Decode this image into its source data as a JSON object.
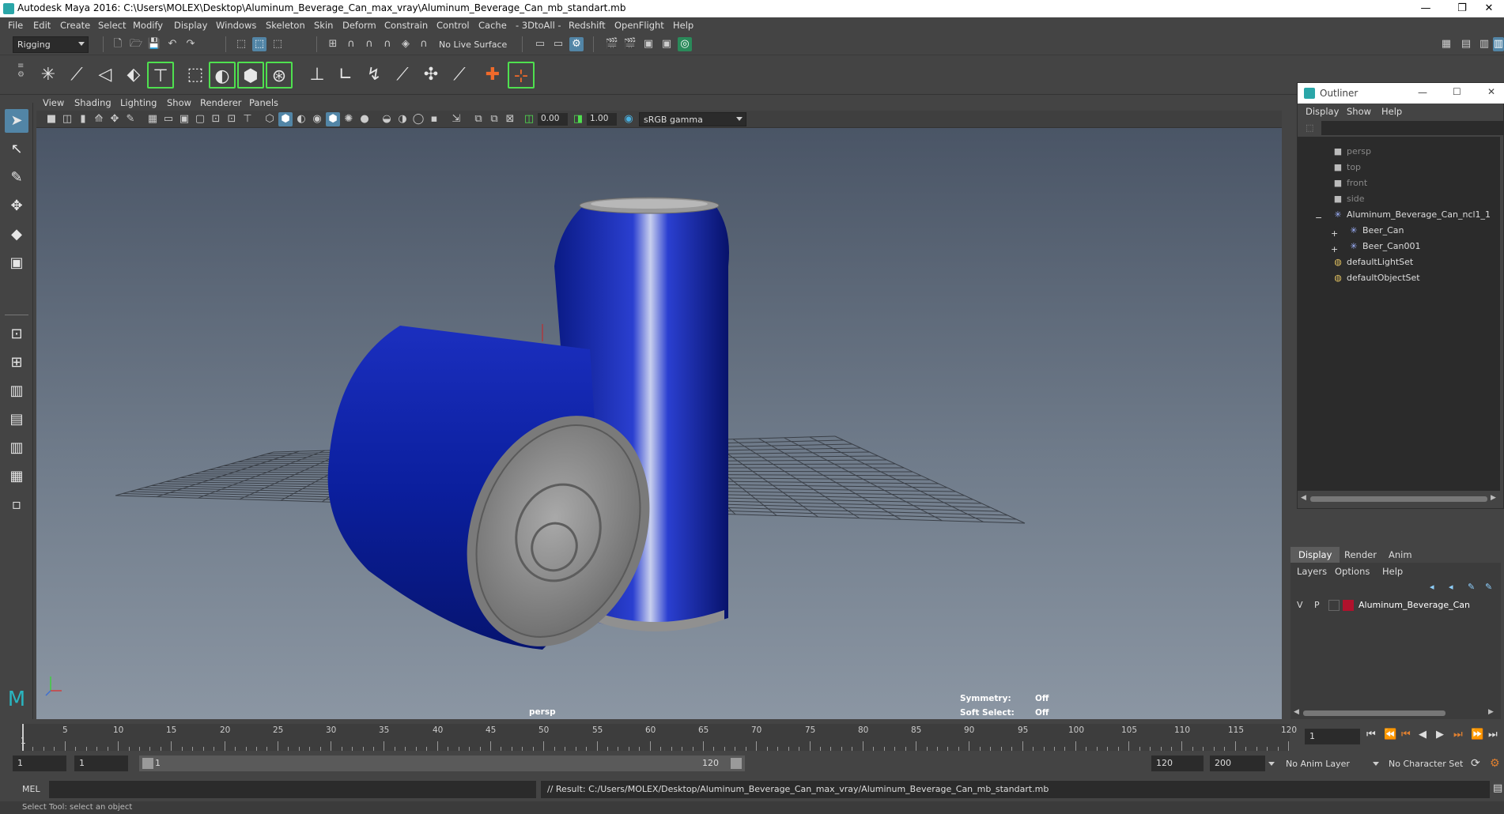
{
  "titlebar": {
    "title": "Autodesk Maya 2016: C:\\Users\\MOLEX\\Desktop\\Aluminum_Beverage_Can_max_vray\\Aluminum_Beverage_Can_mb_standart.mb",
    "minimize": "—",
    "restore": "❐",
    "close": "✕"
  },
  "menubar": [
    "File",
    "Edit",
    "Create",
    "Select",
    "Modify",
    "Display",
    "Windows",
    "Skeleton",
    "Skin",
    "Deform",
    "Constrain",
    "Control",
    "Cache",
    "- 3DtoAll -",
    "Redshift",
    "OpenFlight",
    "Help"
  ],
  "statusline": {
    "menuset": "Rigging",
    "live_surface": "No Live Surface"
  },
  "panel": {
    "menu": [
      "View",
      "Shading",
      "Lighting",
      "Show",
      "Renderer",
      "Panels"
    ],
    "exposure": "0.00",
    "gamma": "1.00",
    "colorspace": "sRGB gamma"
  },
  "viewport": {
    "camera_label": "persp",
    "symmetry_label": "Symmetry:",
    "symmetry_value": "Off",
    "soft_select_label": "Soft Select:",
    "soft_select_value": "Off",
    "can_color": "#0b1f9e",
    "lid_color": "#8a8a8a"
  },
  "outliner": {
    "title": "Outliner",
    "menu": [
      "Display",
      "Show",
      "Help"
    ],
    "items": [
      {
        "label": "persp",
        "icon": "camera-icon",
        "dim": true
      },
      {
        "label": "top",
        "icon": "camera-icon",
        "dim": true
      },
      {
        "label": "front",
        "icon": "camera-icon",
        "dim": true
      },
      {
        "label": "side",
        "icon": "camera-icon",
        "dim": true
      },
      {
        "label": "Aluminum_Beverage_Can_ncl1_1",
        "icon": "transform-icon",
        "expand": "−"
      },
      {
        "label": "Beer_Can",
        "icon": "transform-icon",
        "expand": "+"
      },
      {
        "label": "Beer_Can001",
        "icon": "transform-icon",
        "expand": "+"
      },
      {
        "label": "defaultLightSet",
        "icon": "set-icon"
      },
      {
        "label": "defaultObjectSet",
        "icon": "set-icon"
      }
    ]
  },
  "layers": {
    "tabs": [
      "Display",
      "Render",
      "Anim"
    ],
    "menu": [
      "Layers",
      "Options",
      "Help"
    ],
    "row": {
      "v": "V",
      "p": "P",
      "name": "Aluminum_Beverage_Can",
      "color": "#b0122c"
    }
  },
  "timeslider": {
    "ticks": [
      "5",
      "10",
      "15",
      "20",
      "25",
      "30",
      "35",
      "40",
      "45",
      "50",
      "55",
      "60",
      "65",
      "70",
      "75",
      "80",
      "85",
      "90",
      "95",
      "100",
      "105",
      "110",
      "115",
      "120"
    ],
    "start_marker": "1",
    "current_frame": "1"
  },
  "rangeslider": {
    "start": "1",
    "playback_start": "1",
    "range_start": "1",
    "range_end": "120",
    "playback_end": "120",
    "end": "200",
    "anim_layer": "No Anim Layer",
    "character_set": "No Character Set"
  },
  "cmdline": {
    "language": "MEL",
    "result": "// Result: C:/Users/MOLEX/Desktop/Aluminum_Beverage_Can_max_vray/Aluminum_Beverage_Can_mb_standart.mb"
  },
  "helpline": {
    "text": "Select Tool: select an object"
  }
}
